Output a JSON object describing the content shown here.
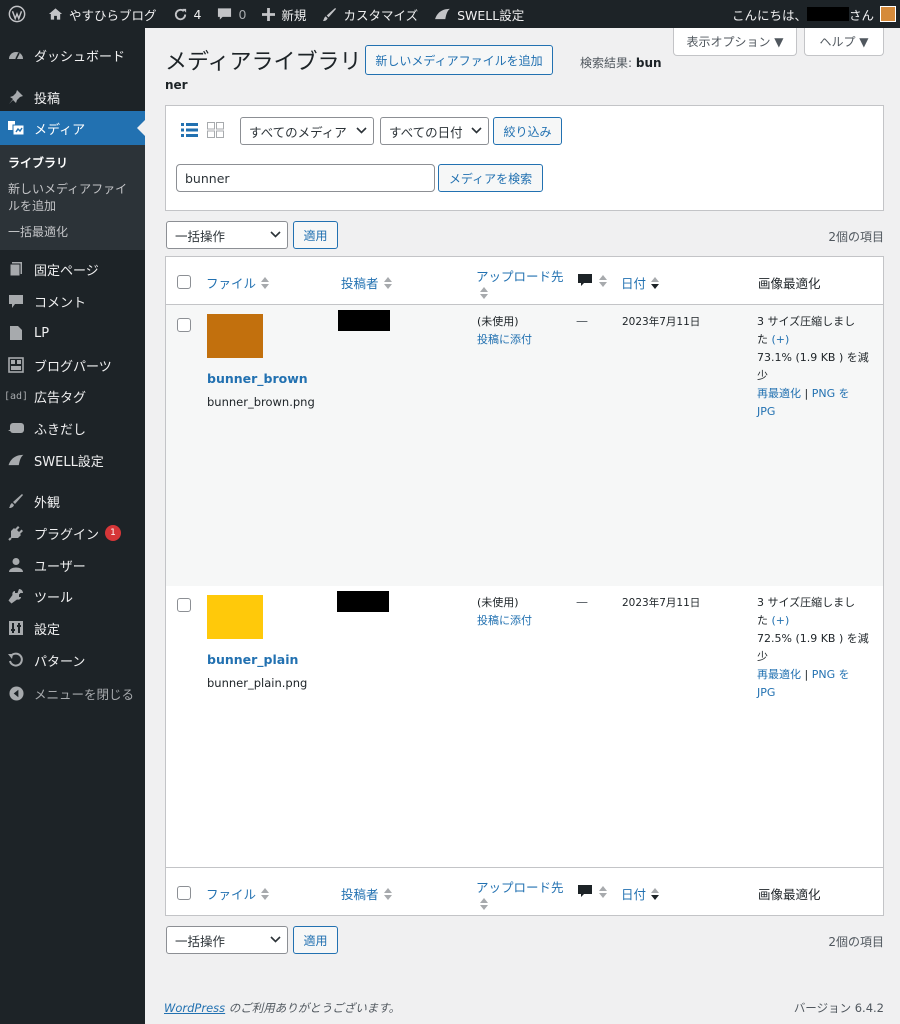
{
  "adminbar": {
    "site_name": "やすひらブログ",
    "updates_count": "4",
    "comments_count": "0",
    "new_label": "新規",
    "customize_label": "カスタマイズ",
    "swell_label": "SWELL設定",
    "greeting": "こんにちは、",
    "greeting_suffix": "さん"
  },
  "sidebar": {
    "items": [
      {
        "label": "ダッシュボード",
        "icon": "dashboard-icon"
      },
      {
        "label": "投稿",
        "icon": "pin-icon"
      },
      {
        "label": "メディア",
        "icon": "media-icon"
      },
      {
        "label": "固定ページ",
        "icon": "page-icon"
      },
      {
        "label": "コメント",
        "icon": "comment-icon"
      },
      {
        "label": "LP",
        "icon": "document-icon"
      },
      {
        "label": "ブログパーツ",
        "icon": "blocks-icon"
      },
      {
        "label": "広告タグ",
        "icon": "ad-icon"
      },
      {
        "label": "ふきだし",
        "icon": "bubble-icon"
      },
      {
        "label": "SWELL設定",
        "icon": "swell-icon"
      },
      {
        "label": "外観",
        "icon": "brush-icon"
      },
      {
        "label": "プラグイン",
        "icon": "plugin-icon",
        "badge": "1"
      },
      {
        "label": "ユーザー",
        "icon": "user-icon"
      },
      {
        "label": "ツール",
        "icon": "wrench-icon"
      },
      {
        "label": "設定",
        "icon": "settings-icon"
      },
      {
        "label": "パターン",
        "icon": "pattern-icon"
      },
      {
        "label": "メニューを閉じる",
        "icon": "collapse-icon"
      }
    ],
    "submenu": {
      "library": "ライブラリ",
      "add_new": "新しいメディアファイルを追加",
      "optimize": "一括最適化"
    }
  },
  "header": {
    "title": "メディアライブラリ",
    "add_new_button": "新しいメディアファイルを追加",
    "search_result_label": "検索結果: ",
    "search_result_term_a": "bun",
    "search_result_term_b": "ner",
    "screen_options": "表示オプション ▼",
    "help": "ヘルプ ▼"
  },
  "filters": {
    "media_type": "すべてのメディア",
    "date": "すべての日付",
    "filter_button": "絞り込み",
    "search_value": "bunner",
    "search_button": "メディアを検索"
  },
  "bulk": {
    "action": "一括操作",
    "apply": "適用",
    "count": "2個の項目"
  },
  "table": {
    "columns": {
      "file": "ファイル",
      "author": "投稿者",
      "uploaded_to": "アップロード先",
      "date": "日付",
      "optimization": "画像最適化"
    },
    "rows": [
      {
        "title": "bunner_brown",
        "filename": "bunner_brown.png",
        "color": "#c2700d",
        "uploaded_to": "(未使用)",
        "attach": "投稿に添付",
        "comments": "—",
        "date": "2023年7月11日",
        "opt_line1": "3 サイズ圧縮しまし",
        "opt_line2a": "た ",
        "opt_line2b": "(+)",
        "opt_line3": "73.1% (1.9 KB ) を減",
        "opt_line4": "少",
        "reopt": "再最適化",
        "sep": " | ",
        "png_to": "PNG を",
        "jpg": "JPG"
      },
      {
        "title": "bunner_plain",
        "filename": "bunner_plain.png",
        "color": "#ffc90a",
        "uploaded_to": "(未使用)",
        "attach": "投稿に添付",
        "comments": "—",
        "date": "2023年7月11日",
        "opt_line1": "3 サイズ圧縮しまし",
        "opt_line2a": "た ",
        "opt_line2b": "(+)",
        "opt_line3": "72.5% (1.9 KB ) を減",
        "opt_line4": "少",
        "reopt": "再最適化",
        "sep": " | ",
        "png_to": "PNG を",
        "jpg": "JPG"
      }
    ]
  },
  "footer": {
    "wordpress_link": "WordPress",
    "thanks": " のご利用ありがとうございます。",
    "version": "バージョン 6.4.2"
  }
}
